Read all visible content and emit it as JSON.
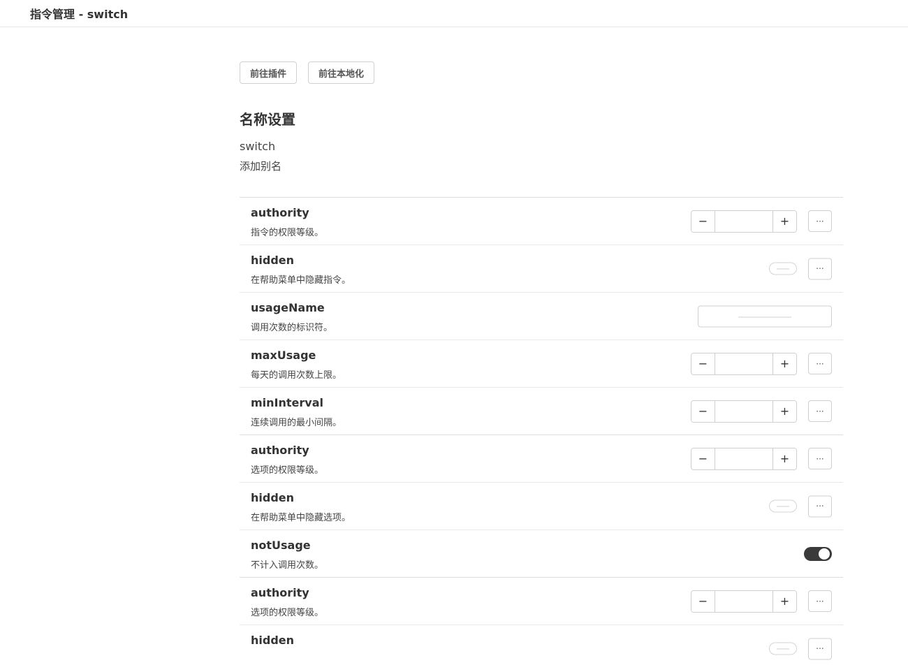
{
  "header": {
    "title": "指令管理 - switch"
  },
  "nav": {
    "plugin_label": "前往插件",
    "locale_label": "前往本地化"
  },
  "name_section": {
    "title": "名称设置",
    "name": "switch",
    "add_alias_label": "添加别名"
  },
  "groups": [
    {
      "rows": [
        {
          "name": "authority",
          "desc": "指令的权限等级。",
          "control": "stepper"
        },
        {
          "name": "hidden",
          "desc": "在帮助菜单中隐藏指令。",
          "control": "toggle-off"
        },
        {
          "name": "usageName",
          "desc": "调用次数的标识符。",
          "control": "text"
        },
        {
          "name": "maxUsage",
          "desc": "每天的调用次数上限。",
          "control": "stepper"
        },
        {
          "name": "minInterval",
          "desc": "连续调用的最小间隔。",
          "control": "stepper"
        }
      ]
    },
    {
      "rows": [
        {
          "name": "authority",
          "desc": "选项的权限等级。",
          "control": "stepper"
        },
        {
          "name": "hidden",
          "desc": "在帮助菜单中隐藏选项。",
          "control": "toggle-off"
        },
        {
          "name": "notUsage",
          "desc": "不计入调用次数。",
          "control": "toggle-on"
        }
      ]
    },
    {
      "rows": [
        {
          "name": "authority",
          "desc": "选项的权限等级。",
          "control": "stepper"
        },
        {
          "name": "hidden",
          "desc": "",
          "control": "toggle-off"
        }
      ]
    }
  ],
  "controls": {
    "minus": "−",
    "plus": "+",
    "more": "···"
  }
}
